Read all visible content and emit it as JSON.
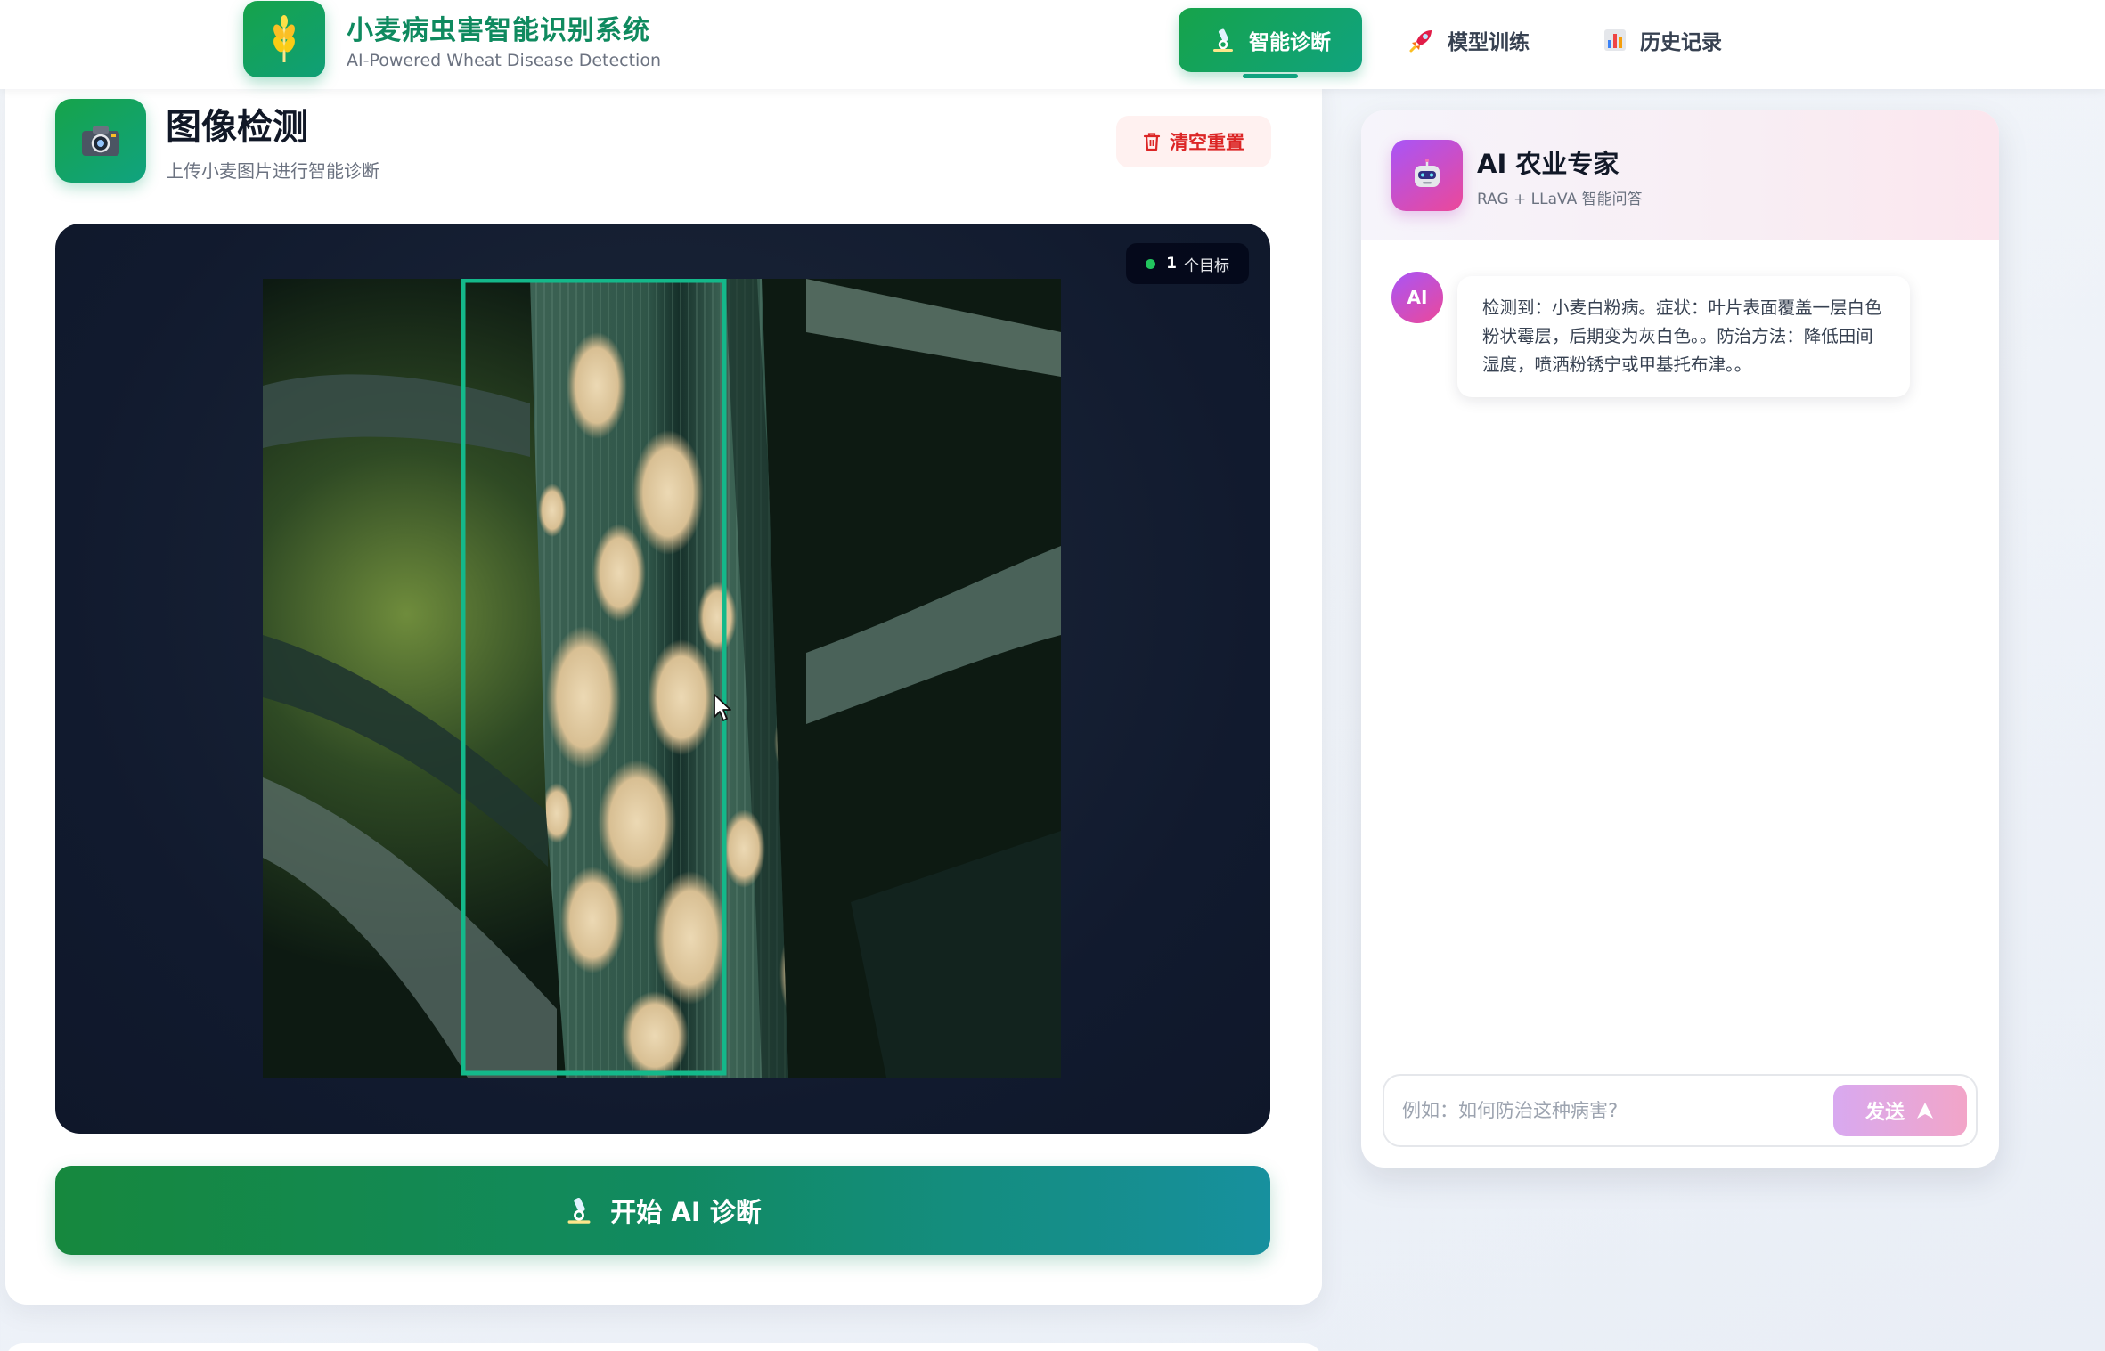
{
  "header": {
    "title": "小麦病虫害智能识别系统",
    "subtitle": "AI-Powered Wheat Disease Detection",
    "logo_icon": "wheat-icon",
    "nav": [
      {
        "label": "智能诊断",
        "icon": "microscope-icon",
        "active": true
      },
      {
        "label": "模型训练",
        "icon": "rocket-icon",
        "active": false
      },
      {
        "label": "历史记录",
        "icon": "bar-chart-icon",
        "active": false
      }
    ]
  },
  "detection": {
    "title": "图像检测",
    "subtitle": "上传小麦图片进行智能诊断",
    "header_icon": "camera-icon",
    "reset_label": "清空重置",
    "target_count": "1",
    "target_label": "个目标",
    "start_label": "开始 AI 诊断"
  },
  "chat": {
    "title": "AI 农业专家",
    "subtitle": "RAG + LLaVA 智能问答",
    "avatar_label": "AI",
    "messages": [
      {
        "role": "ai",
        "text": "检测到：小麦白粉病。症状：叶片表面覆盖一层白色粉状霉层，后期变为灰白色。。防治方法：降低田间湿度，喷洒粉锈宁或甲基托布津。。"
      }
    ],
    "input_placeholder": "例如：如何防治这种病害?",
    "send_label": "发送"
  },
  "colors": {
    "brand_green": "#16a34a",
    "brand_teal": "#10a37f",
    "detection_box": "#14b88a",
    "danger": "#dc2626",
    "ai_gradient_start": "#a855f7",
    "ai_gradient_end": "#ec4899"
  }
}
